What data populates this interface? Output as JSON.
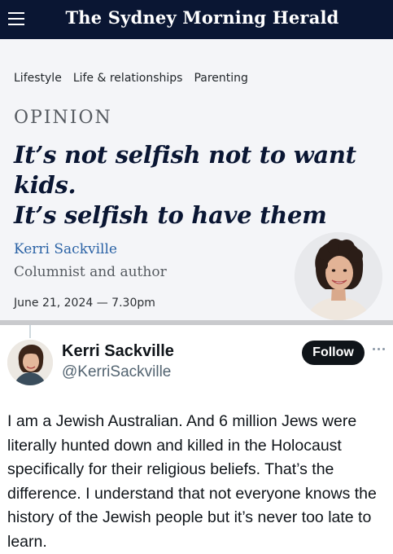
{
  "header": {
    "masthead": "The Sydney Morning Herald",
    "menu_icon": "hamburger-menu-icon",
    "bg_color": "#0a1633"
  },
  "article": {
    "breadcrumb": [
      "Lifestyle",
      "Life & relationships",
      "Parenting"
    ],
    "kicker": "OPINION",
    "headline_line1": "It’s not selfish not to want kids.",
    "headline_line2": "It’s selfish to have them",
    "author_name": "Kerri Sackville",
    "author_role": "Columnist and author",
    "published": "June 21, 2024 — 7.30pm",
    "author_link_color": "#2a62a5"
  },
  "tweet": {
    "display_name": "Kerri Sackville",
    "handle": "@KerriSackville",
    "follow_label": "Follow",
    "more_icon": "more-horizontal-icon",
    "text": "I am a Jewish Australian. And 6 million Jews were literally hunted down and killed in the Holocaust specifically for their religious beliefs. That’s the difference. I understand that not everyone knows the history of the Jewish people but it’s never too late to learn."
  }
}
